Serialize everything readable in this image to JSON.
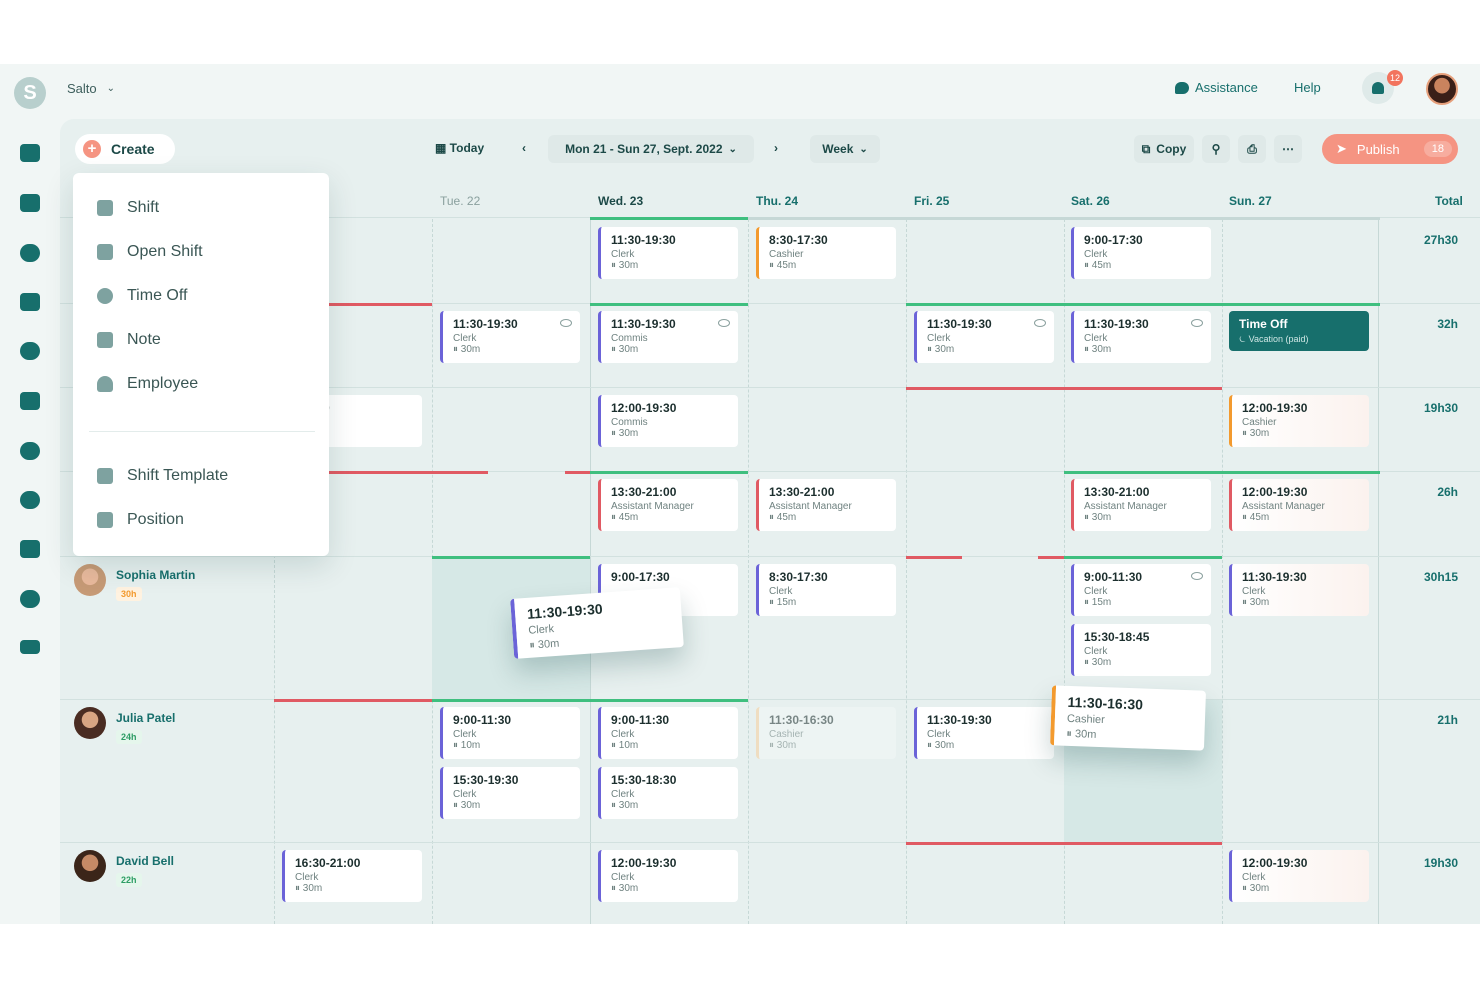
{
  "header": {
    "logo_letter": "S",
    "workspace": "Salto",
    "assistance": "Assistance",
    "help": "Help",
    "notifications": "12"
  },
  "toolbar": {
    "create": "Create",
    "today": "Today",
    "date_range": "Mon 21 - Sun 27, Sept. 2022",
    "view": "Week",
    "copy": "Copy",
    "publish": "Publish",
    "publish_count": "18"
  },
  "menu": {
    "items": [
      "Shift",
      "Open Shift",
      "Time Off",
      "Note",
      "Employee"
    ],
    "templates": [
      "Shift Template",
      "Position"
    ]
  },
  "days": [
    "Tue. 22",
    "Wed. 23",
    "Thu. 24",
    "Fri. 25",
    "Sat. 26",
    "Sun. 27"
  ],
  "total_label": "Total",
  "rows": [
    {
      "total": "27h30"
    },
    {
      "total": "32h"
    },
    {
      "total": "19h30"
    },
    {
      "total": "26h"
    },
    {
      "name": "Sophia Martin",
      "hours": "30h",
      "total": "30h15"
    },
    {
      "name": "Julia Patel",
      "hours": "24h",
      "total": "21h"
    },
    {
      "name": "David Bell",
      "hours": "22h",
      "total": "19h30"
    }
  ],
  "partial_time": "-21:00",
  "shifts": [
    {
      "time": "11:30-19:30",
      "role": "Clerk",
      "pause": "⏸ 30m"
    },
    {
      "time": "8:30-17:30",
      "role": "Cashier",
      "pause": "⏸ 45m"
    },
    {
      "time": "9:00-17:30",
      "role": "Clerk",
      "pause": "⏸ 45m"
    },
    {
      "time": "11:30-19:30",
      "role": "Clerk",
      "pause": "⏸ 30m"
    },
    {
      "time": "11:30-19:30",
      "role": "Commis",
      "pause": "⏸ 30m"
    },
    {
      "time": "11:30-19:30",
      "role": "Clerk",
      "pause": "⏸ 30m"
    },
    {
      "time": "11:30-19:30",
      "role": "Clerk",
      "pause": "⏸ 30m"
    },
    {
      "time": "12:00-19:30",
      "role": "Commis",
      "pause": "⏸ 30m"
    },
    {
      "time": "12:00-19:30",
      "role": "Cashier",
      "pause": "⏸ 30m"
    },
    {
      "time": "13:30-21:00",
      "role": "Assistant Manager",
      "pause": "⏸ 45m"
    },
    {
      "time": "13:30-21:00",
      "role": "Assistant Manager",
      "pause": "⏸ 45m"
    },
    {
      "time": "13:30-21:00",
      "role": "Assistant Manager",
      "pause": "⏸ 30m"
    },
    {
      "time": "12:00-19:30",
      "role": "Assistant Manager",
      "pause": "⏸ 45m"
    },
    {
      "time": "9:00-17:30",
      "role": "",
      "pause": ""
    },
    {
      "time": "8:30-17:30",
      "role": "Clerk",
      "pause": "⏸ 15m"
    },
    {
      "time": "9:00-11:30",
      "role": "Clerk",
      "pause": "⏸ 15m"
    },
    {
      "time": "11:30-19:30",
      "role": "Clerk",
      "pause": "⏸ 30m"
    },
    {
      "time": "15:30-18:45",
      "role": "Clerk",
      "pause": "⏸ 30m"
    },
    {
      "time": "9:00-11:30",
      "role": "Clerk",
      "pause": "⏸ 10m"
    },
    {
      "time": "9:00-11:30",
      "role": "Clerk",
      "pause": "⏸ 10m"
    },
    {
      "time": "11:30-16:30",
      "role": "Cashier",
      "pause": "⏸ 30m"
    },
    {
      "time": "11:30-19:30",
      "role": "Clerk",
      "pause": "⏸ 30m"
    },
    {
      "time": "15:30-19:30",
      "role": "Clerk",
      "pause": "⏸ 30m"
    },
    {
      "time": "15:30-18:30",
      "role": "Clerk",
      "pause": "⏸ 30m"
    },
    {
      "time": "16:30-21:00",
      "role": "Clerk",
      "pause": "⏸ 30m"
    },
    {
      "time": "12:00-19:30",
      "role": "Clerk",
      "pause": "⏸ 30m"
    },
    {
      "time": "12:00-19:30",
      "role": "Clerk",
      "pause": "⏸ 30m"
    }
  ],
  "timeoff": {
    "title": "Time Off",
    "sub": "⏾ Vacation (paid)"
  },
  "dragged": [
    {
      "time": "11:30-19:30",
      "role": "Clerk",
      "pause": "⏸ 30m"
    },
    {
      "time": "11:30-16:30",
      "role": "Cashier",
      "pause": "⏸ 30m"
    }
  ],
  "colors": {
    "primary": "#176f6c",
    "accent": "#f59482",
    "purple": "#6b63d8",
    "orange": "#f39a2e",
    "red": "#e05a63",
    "green": "#3fbf7f"
  }
}
